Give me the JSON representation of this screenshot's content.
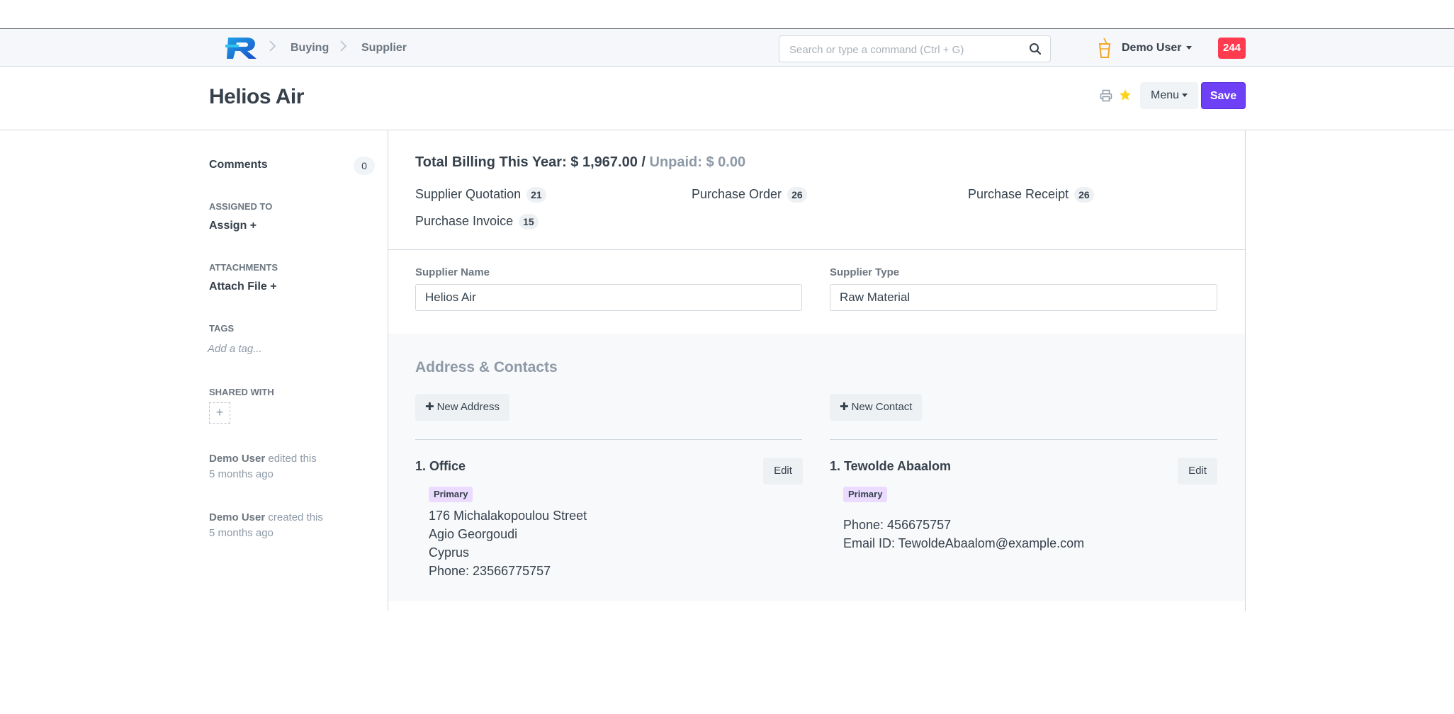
{
  "navbar": {
    "breadcrumbs": [
      "Buying",
      "Supplier"
    ],
    "search_placeholder": "Search or type a command (Ctrl + G)",
    "user_name": "Demo User",
    "notification_count": "244",
    "badge_color": "#ff3b4f"
  },
  "header": {
    "title": "Helios Air",
    "menu_label": "Menu",
    "save_label": "Save",
    "accent_color": "#6e40f6"
  },
  "sidebar": {
    "comments_label": "Comments",
    "comments_count": "0",
    "assigned_to_label": "ASSIGNED TO",
    "assign_link": "Assign +",
    "attachments_label": "ATTACHMENTS",
    "attach_link": "Attach File +",
    "tags_label": "TAGS",
    "tag_placeholder": "Add a tag...",
    "shared_with_label": "SHARED WITH",
    "share_add_symbol": "+",
    "activity": [
      {
        "user": "Demo User",
        "action": " edited this",
        "time": "5 months ago"
      },
      {
        "user": "Demo User",
        "action": " created this",
        "time": "5 months ago"
      }
    ]
  },
  "dashboard": {
    "billing_label": "Total Billing This Year: $ 1,967.00 / ",
    "unpaid_label": "Unpaid: $ 0.00",
    "stats": [
      {
        "label": "Supplier Quotation",
        "count": "21"
      },
      {
        "label": "Purchase Order",
        "count": "26"
      },
      {
        "label": "Purchase Receipt",
        "count": "26"
      },
      {
        "label": "Purchase Invoice",
        "count": "15"
      }
    ]
  },
  "form": {
    "supplier_name_label": "Supplier Name",
    "supplier_name_value": "Helios Air",
    "supplier_type_label": "Supplier Type",
    "supplier_type_value": "Raw Material"
  },
  "address_contacts": {
    "section_title": "Address & Contacts",
    "new_address_label": "New Address",
    "new_contact_label": "New Contact",
    "address": {
      "title": "1. Office",
      "badge": "Primary",
      "edit_label": "Edit",
      "lines": [
        "176 Michalakopoulou Street",
        "Agio Georgoudi",
        "Cyprus",
        "Phone: 23566775757"
      ]
    },
    "contact": {
      "title": "1. Tewolde Abaalom",
      "badge": "Primary",
      "edit_label": "Edit",
      "lines": [
        "Phone: 456675757",
        "Email ID: TewoldeAbaalom@example.com"
      ]
    }
  }
}
